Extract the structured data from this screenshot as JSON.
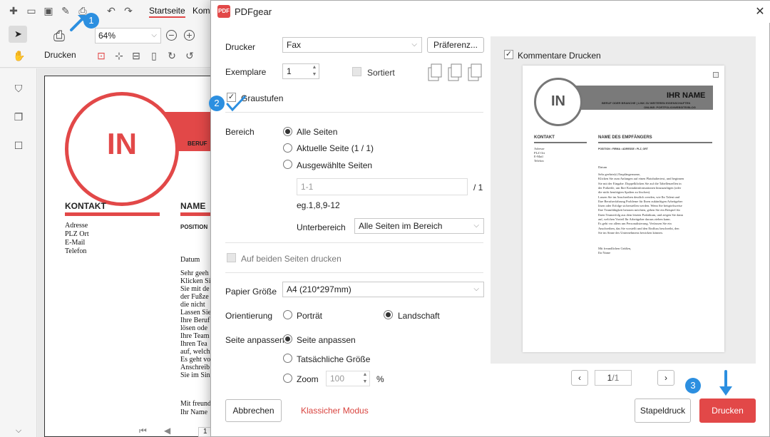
{
  "background_app": {
    "tabs": [
      "Startseite",
      "Kom"
    ],
    "print_label": "Drucken",
    "zoom": "64%",
    "resume": {
      "initials": "IN",
      "partial_header": "BERUF",
      "kontakt_heading": "KONTAKT",
      "kontakt_items": [
        "Adresse",
        "PLZ Ort",
        "E-Mail",
        "Telefon"
      ],
      "name_partial": "NAME",
      "position_partial": "POSITION",
      "datum": "Datum",
      "body_lines": [
        "Sehr geeh",
        "Klicken Si",
        "Sie mit de",
        "der Fußze",
        "die nicht",
        "Lassen Sie",
        "Ihre Beruf",
        "lösen ode",
        "Ihre Team",
        "Ihren Tea",
        "auf, welch",
        "Es geht vo",
        "Anschreib",
        "Sie im Sin"
      ],
      "closing_lines": [
        "Mit freund",
        "Ihr Name"
      ]
    },
    "page_number": "1"
  },
  "dialog": {
    "title": "PDFgear",
    "printer": {
      "label": "Drucker",
      "value": "Fax",
      "preferences_button": "Präferenz..."
    },
    "copies": {
      "label": "Exemplare",
      "value": "1",
      "collate_label": "Sortiert"
    },
    "grayscale": {
      "label": "Graustufen",
      "checked": true
    },
    "range": {
      "label": "Bereich",
      "options": [
        "Alle Seiten",
        "Aktuelle Seite (1 / 1)",
        "Ausgewählte Seiten"
      ],
      "selected": "Alle Seiten",
      "pages_placeholder": "1-1",
      "page_total": "/ 1",
      "example": "eg.1,8,9-12",
      "subrange_label": "Unterbereich",
      "subrange_value": "Alle Seiten im Bereich"
    },
    "duplex": {
      "label": "Auf beiden Seiten drucken"
    },
    "paper": {
      "label": "Papier Größe",
      "value": "A4 (210*297mm)"
    },
    "orientation": {
      "label": "Orientierung",
      "portrait": "Porträt",
      "landscape": "Landschaft",
      "selected": "Landschaft"
    },
    "fit": {
      "label": "Seite anpassen",
      "options": [
        "Seite anpassen",
        "Tatsächliche Größe",
        "Zoom"
      ],
      "selected": "Seite anpassen",
      "zoom_value": "100",
      "zoom_unit": "%"
    },
    "preview": {
      "comments_label": "Kommentare Drucken",
      "page_input": "1",
      "page_total": "/1"
    },
    "buttons": {
      "cancel": "Abbrechen",
      "classic": "Klassicher Modus",
      "batch": "Stapeldruck",
      "print": "Drucken"
    },
    "colors": {
      "accent": "#e24848",
      "classic_link": "#d9443f"
    }
  },
  "preview_page": {
    "initials": "IN",
    "name": "IHR NAME",
    "tagline": "BERUF ODER BRANCHE | LINK ZU WEITEREN EIGENSCHAFTEN",
    "tagline2": "ONLINE: PORTFOLIO/WEBSITE/BLOG",
    "kontakt": "KONTAKT",
    "kontakt_items": [
      "Adresse",
      "PLZ Ort",
      "E-Mail",
      "Telefon"
    ],
    "recipient": "NAME DES EMPFÄNGERS",
    "position_line": "POSITION • FIRMA • ADRESSE • PLZ, ORT",
    "datum": "Datum",
    "body": [
      "Sehr geehrte(r) Empfängername,",
      "Klicken Sie zum Anfangen auf einen Platzhaltertext, und beginnen",
      "Sie mit der Eingabe. Doppelklicken Sie auf die Tabellenzellen in",
      "der Fußzeile, um Ihre Kontaktinformationen hinzuzufügen (oder",
      "die nicht benötigten Spalten zu löschen).",
      "Lassen Sie im Anschreiben deutlich werden, wie Ihr Talent und",
      "Ihre Berufserfahrung Probleme für Ihren zukünftigen Arbeitgeber",
      "lösen oder Erfolge sicherstellen werden. Wenn Sie beispielsweise",
      "Ihre Teamfähigkeit betonen möchten, geben Sie ein Beispiel für",
      "Ihren Teamerfolg aus dem letzten Praktikum, und zeigen Sie dann",
      "auf, welchen Vorteil Ihr Arbeitgeber daraus ziehen kann.",
      "Es geht vor allem um Personalisierung. Verfassen Sie ein",
      "Anschreiben, das Sie vorstellt und den Einfluss beschreibt, den",
      "Sie im Sinne des Unternehmens bewirken können."
    ],
    "closing": [
      "Mit freundlichen Grüßen,",
      "Ihr Name"
    ]
  },
  "annotations": {
    "badge1": "1",
    "badge2": "2",
    "badge3": "3",
    "badge_color": "#2c8fe0"
  }
}
